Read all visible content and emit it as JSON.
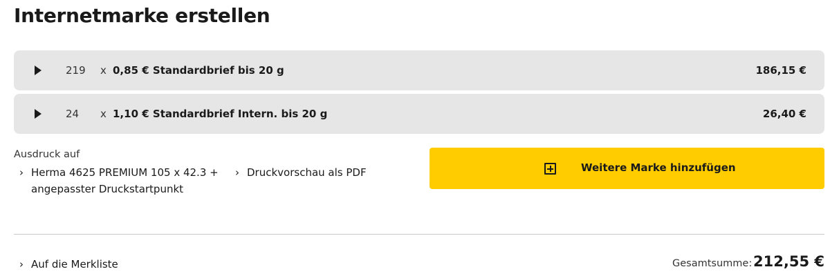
{
  "page": {
    "title": "Internetmarke erstellen"
  },
  "items": [
    {
      "quantity": "219",
      "times": "x",
      "description": "0,85 € Standardbrief bis 20 g",
      "price": "186,15 €"
    },
    {
      "quantity": "24",
      "times": "x",
      "description": "1,10 € Standardbrief Intern. bis 20 g",
      "price": "26,40 €"
    }
  ],
  "print": {
    "label": "Ausdruck auf",
    "format_link": {
      "line1": "Herma 4625 PREMIUM 105 x 42.3 +",
      "line2": "angepasster Druckstartpunkt",
      "icon": "chevron-right-icon"
    },
    "preview_link": {
      "label": "Druckvorschau als PDF",
      "icon": "chevron-right-icon"
    }
  },
  "add_button": {
    "label": "Weitere Marke hinzufügen",
    "icon": "plus-square-icon",
    "color": "#ffcc00"
  },
  "footer": {
    "watchlist_link": "Auf die Merkliste",
    "total_label": "Gesamtsumme:",
    "total_value": "212,55 €"
  },
  "colors": {
    "row_background": "#e6e6e6",
    "accent": "#ffcc00",
    "text": "#1a1a1a"
  }
}
